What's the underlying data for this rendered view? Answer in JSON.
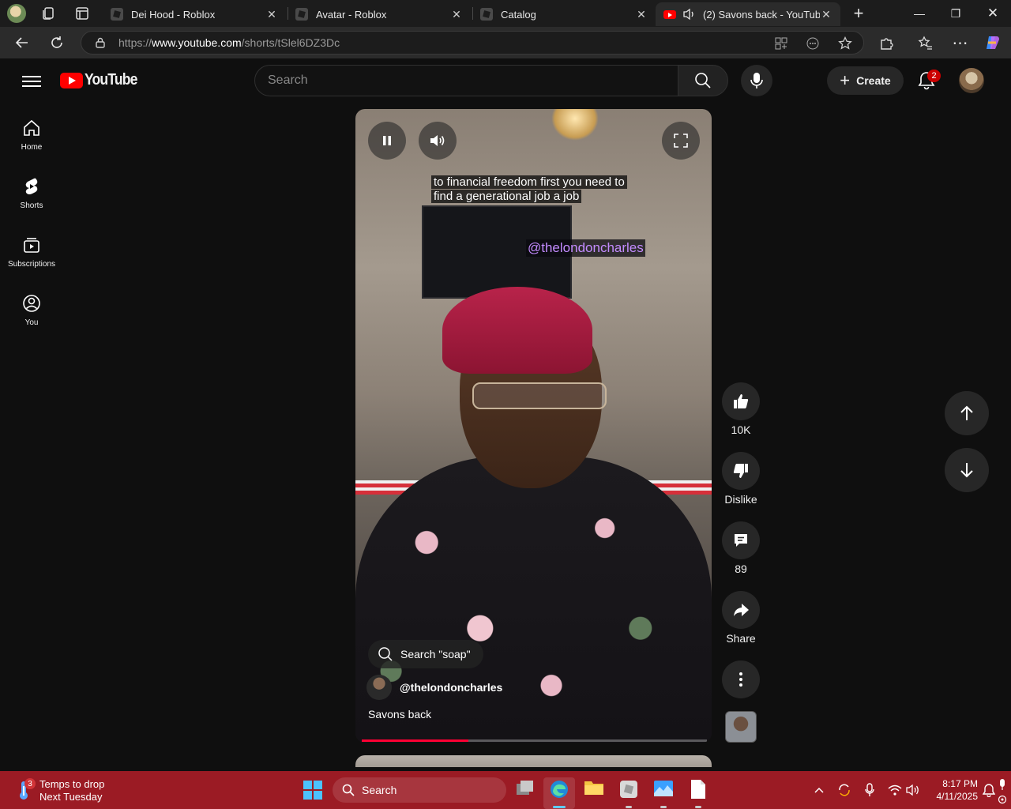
{
  "browser": {
    "tabs": [
      {
        "label": "Dei Hood - Roblox"
      },
      {
        "label": "Avatar - Roblox"
      },
      {
        "label": "Catalog"
      },
      {
        "label": "(2) Savons back - YouTube"
      }
    ],
    "url_prefix": "https://",
    "url_host": "www.youtube.com",
    "url_path": "/shorts/tSlel6DZ3Dc"
  },
  "youtube": {
    "logo_text": "YouTube",
    "search_placeholder": "Search",
    "create_label": "Create",
    "notification_count": "2",
    "guide": [
      {
        "label": "Home"
      },
      {
        "label": "Shorts"
      },
      {
        "label": "Subscriptions"
      },
      {
        "label": "You"
      }
    ]
  },
  "short": {
    "caption": "to financial freedom first you need to find a generational job a job",
    "watermark": "@thelondoncharles",
    "search_chip": "Search \"soap\"",
    "channel": "@thelondoncharles",
    "title": "Savons back",
    "progress": 0.31
  },
  "actions": {
    "like_count": "10K",
    "dislike_label": "Dislike",
    "comment_count": "89",
    "share_label": "Share"
  },
  "taskbar": {
    "weather_badge": "3",
    "weather_line1": "Temps to drop",
    "weather_line2": "Next Tuesday",
    "search_label": "Search",
    "time": "8:17 PM",
    "date": "4/11/2025"
  },
  "colors": {
    "youtube_red": "#ff0000",
    "progress_red": "#ff0033",
    "taskbar": "#9b1b24",
    "watermark_purple": "#c38bff"
  },
  "icons": [
    "menu-icon",
    "search-icon",
    "mic-icon",
    "bell-icon",
    "home-icon",
    "shorts-icon",
    "subscriptions-icon",
    "you-icon",
    "pause-icon",
    "volume-icon",
    "fullscreen-icon",
    "like-icon",
    "dislike-icon",
    "comment-icon",
    "share-icon",
    "more-icon",
    "arrow-up-icon",
    "arrow-down-icon"
  ]
}
